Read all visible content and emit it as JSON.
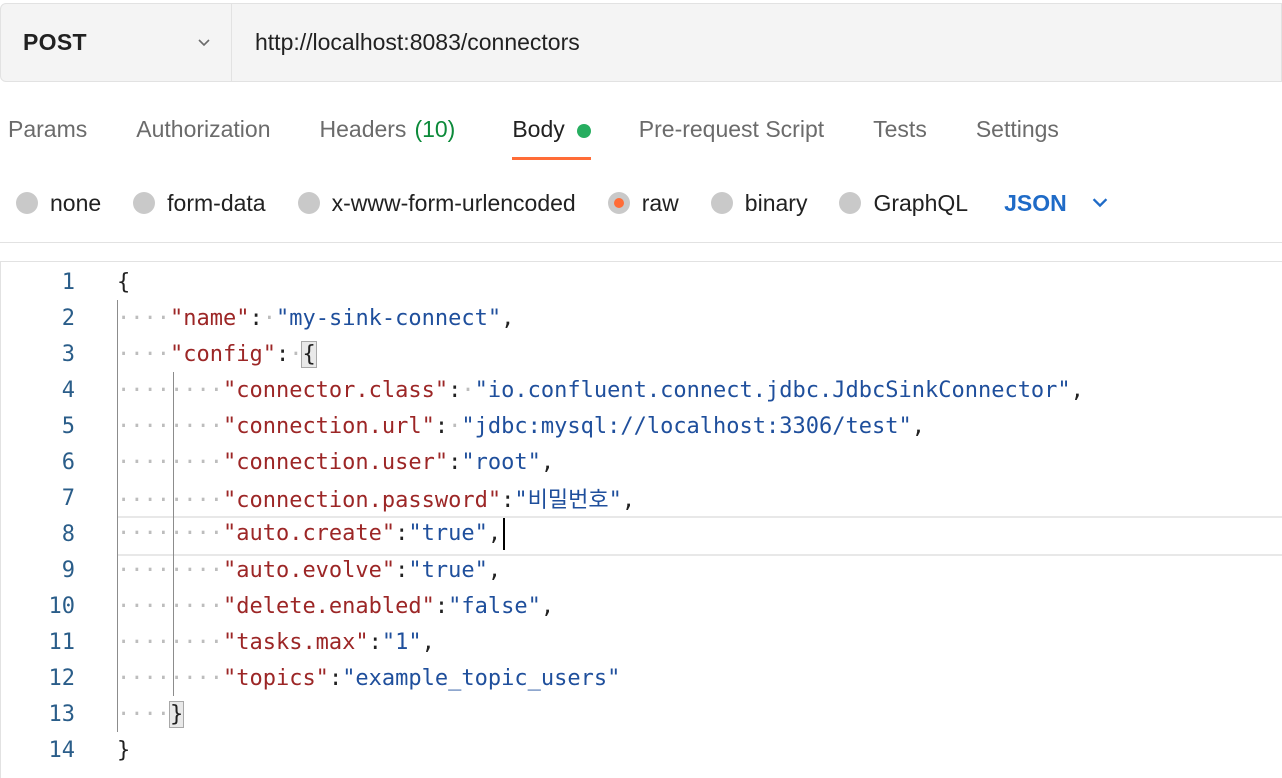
{
  "request": {
    "method": "POST",
    "url": "http://localhost:8083/connectors"
  },
  "tabs": [
    {
      "label": "Params"
    },
    {
      "label": "Authorization"
    },
    {
      "label": "Headers",
      "count": "(10)"
    },
    {
      "label": "Body",
      "active": true
    },
    {
      "label": "Pre-request Script"
    },
    {
      "label": "Tests"
    },
    {
      "label": "Settings"
    }
  ],
  "body_types": [
    {
      "label": "none"
    },
    {
      "label": "form-data"
    },
    {
      "label": "x-www-form-urlencoded"
    },
    {
      "label": "raw",
      "selected": true
    },
    {
      "label": "binary"
    },
    {
      "label": "GraphQL"
    }
  ],
  "format": "JSON",
  "colors": {
    "accent": "#ff6c37",
    "status_dot": "#27ae60",
    "json_key": "#9c2626",
    "json_string": "#1f4f9c",
    "format_link": "#1f6bc7"
  },
  "editor": {
    "current_line": 8,
    "lines": [
      {
        "n": "1",
        "text": "{"
      },
      {
        "n": "2",
        "text": "\"name\": \"my-sink-connect\","
      },
      {
        "n": "3",
        "text": "\"config\": {"
      },
      {
        "n": "4",
        "text": "\"connector.class\": \"io.confluent.connect.jdbc.JdbcSinkConnector\","
      },
      {
        "n": "5",
        "text": "\"connection.url\": \"jdbc:mysql://localhost:3306/test\","
      },
      {
        "n": "6",
        "text": "\"connection.user\":\"root\","
      },
      {
        "n": "7",
        "text": "\"connection.password\":\"비밀번호\","
      },
      {
        "n": "8",
        "text": "\"auto.create\":\"true\","
      },
      {
        "n": "9",
        "text": "\"auto.evolve\":\"true\","
      },
      {
        "n": "10",
        "text": "\"delete.enabled\":\"false\","
      },
      {
        "n": "11",
        "text": "\"tasks.max\":\"1\","
      },
      {
        "n": "12",
        "text": "\"topics\":\"example_topic_users\""
      },
      {
        "n": "13",
        "text": "}"
      },
      {
        "n": "14",
        "text": "}"
      }
    ]
  }
}
